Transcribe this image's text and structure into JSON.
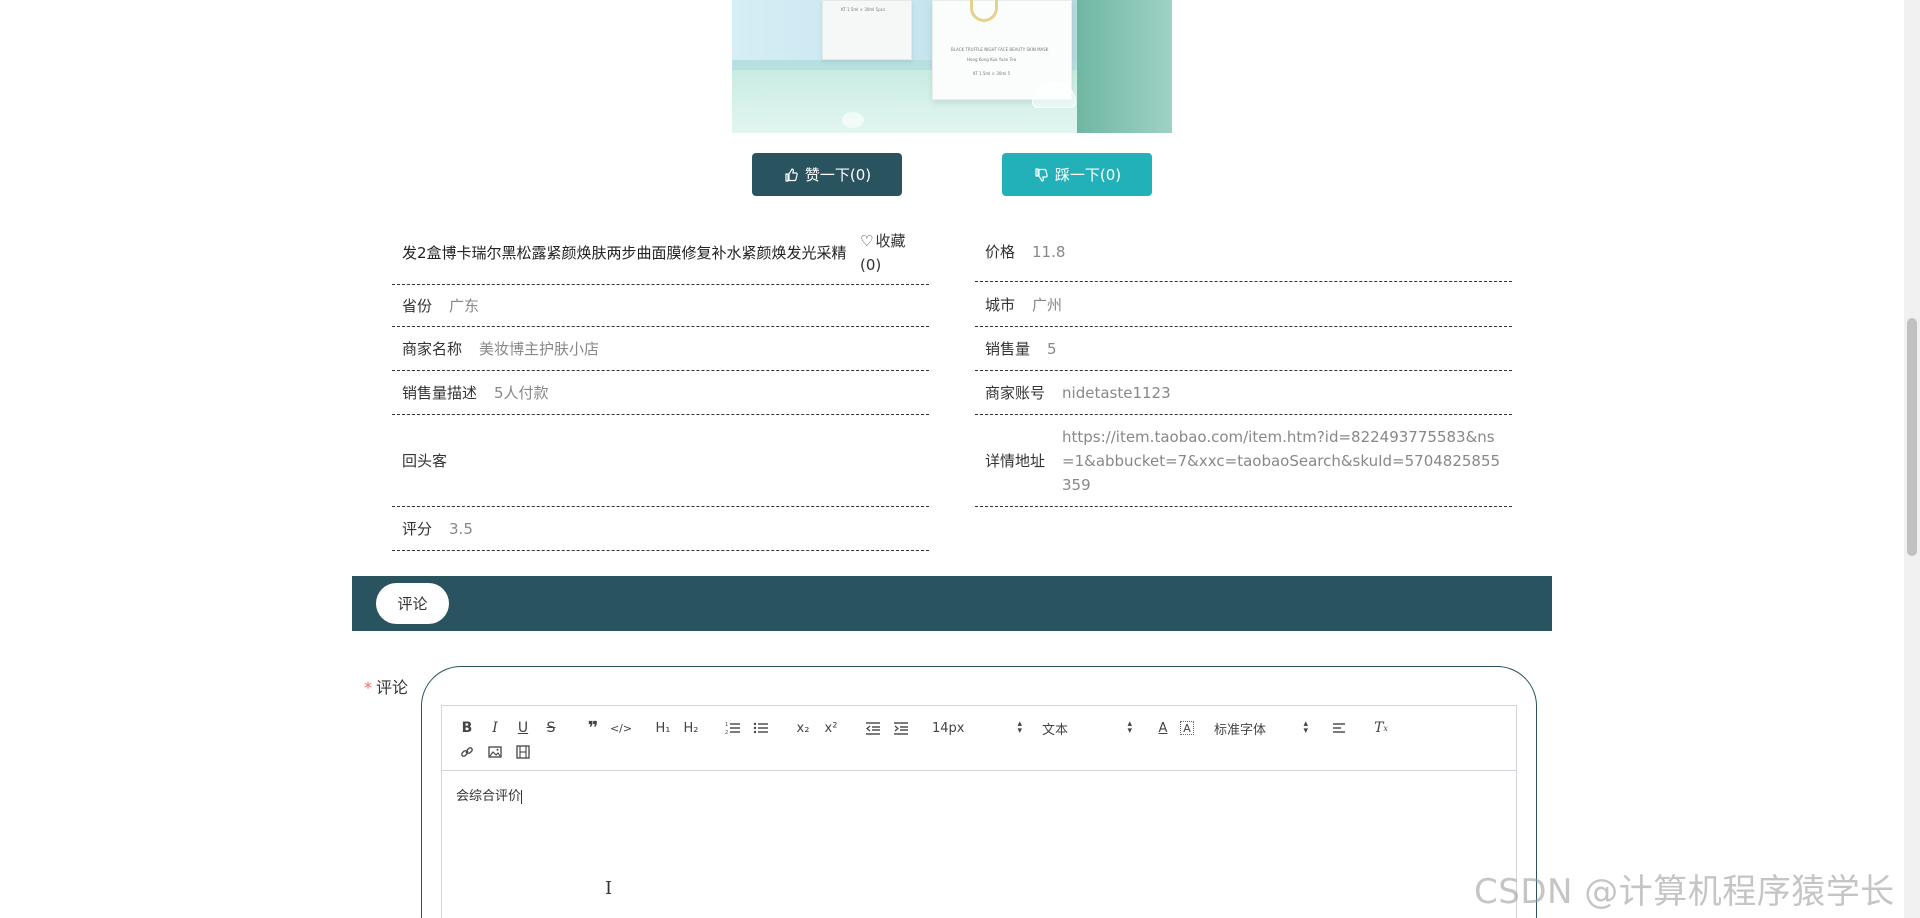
{
  "product_image": {
    "small_texts": [
      "KT 1.5ml × 30ml 5pcs",
      "BLACK TRUFFLE NIGHT FACE BEAUTY SKIN MASK",
      "Hong Kong Kuo Yuan Tea",
      "KT 1.5ml × 30ml 5"
    ]
  },
  "actions": {
    "like_label": "赞一下(0)",
    "dislike_label": "踩一下(0)",
    "like_icon": "thumbs-up-icon",
    "dislike_icon": "thumbs-down-icon"
  },
  "product": {
    "title": "发2盒博卡瑞尔黑松露紧颜焕肤两步曲面膜修复补水紧颜焕发光采精",
    "favorite_label": "收藏",
    "favorite_count": "(0)",
    "fields": {
      "price": {
        "label": "价格",
        "value": "11.8"
      },
      "province": {
        "label": "省份",
        "value": "广东"
      },
      "city": {
        "label": "城市",
        "value": "广州"
      },
      "shop_name": {
        "label": "商家名称",
        "value": "美妆博主护肤小店"
      },
      "sales": {
        "label": "销售量",
        "value": "5"
      },
      "sales_desc": {
        "label": "销售量描述",
        "value": "5人付款"
      },
      "merchant_account": {
        "label": "商家账号",
        "value": "nidetaste1123"
      },
      "repeat_customer": {
        "label": "回头客",
        "value": ""
      },
      "detail_url": {
        "label": "详情地址",
        "value": "https://item.taobao.com/item.htm?id=822493775583&ns=1&abbucket=7&xxc=taobaoSearch&skuId=5704825855359"
      },
      "rating": {
        "label": "评分",
        "value": "3.5"
      }
    }
  },
  "comments": {
    "tab_label": "评论",
    "form_label": "评论",
    "required_mark": "*",
    "editor": {
      "font_size": "14px",
      "block_type": "文本",
      "font_family": "标准字体",
      "content": "会综合评价"
    }
  },
  "watermark": "CSDN @计算机程序猿学长",
  "colors": {
    "primary": "#29535f",
    "accent": "#22b1b9"
  }
}
